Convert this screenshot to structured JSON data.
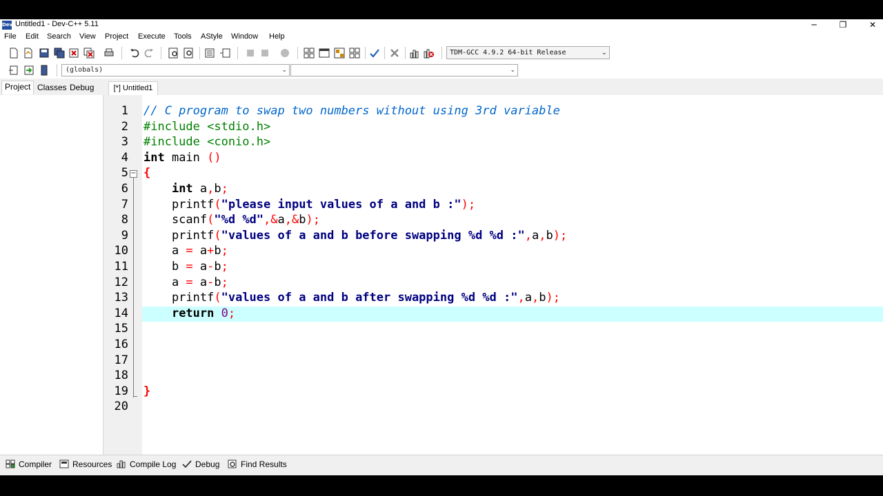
{
  "window": {
    "title": "Untitled1 - Dev-C++ 5.11",
    "app_icon": "Dev",
    "controls": [
      "─",
      "❐",
      "✕"
    ]
  },
  "menu": [
    "File",
    "Edit",
    "Search",
    "View",
    "Project",
    "Execute",
    "Tools",
    "AStyle",
    "Window",
    "Help"
  ],
  "toolbar": {
    "compiler": "TDM-GCC 4.9.2 64-bit Release",
    "scope": "(globals)",
    "member": ""
  },
  "left_tabs": [
    "Project",
    "Classes",
    "Debug"
  ],
  "editor": {
    "tab": "[*] Untitled1",
    "active_line": 14,
    "line_numbers": [
      "1",
      "2",
      "3",
      "4",
      "5",
      "6",
      "7",
      "8",
      "9",
      "10",
      "11",
      "12",
      "13",
      "14",
      "15",
      "16",
      "17",
      "18",
      "19",
      "20"
    ],
    "lines": [
      [
        {
          "t": "// C program to swap two numbers without using 3rd variable",
          "c": "comment"
        }
      ],
      [
        {
          "t": "#include <stdio.h>",
          "c": "pre"
        }
      ],
      [
        {
          "t": "#include <conio.h>",
          "c": "pre"
        }
      ],
      [
        {
          "t": "int",
          "c": "kw"
        },
        {
          "t": " main ",
          "c": "plain"
        },
        {
          "t": "()",
          "c": "sym"
        }
      ],
      [
        {
          "t": "{",
          "c": "brace"
        }
      ],
      [
        {
          "t": "    ",
          "c": "plain"
        },
        {
          "t": "int",
          "c": "kw"
        },
        {
          "t": " a",
          "c": "plain"
        },
        {
          "t": ",",
          "c": "sym"
        },
        {
          "t": "b",
          "c": "plain"
        },
        {
          "t": ";",
          "c": "sym"
        }
      ],
      [
        {
          "t": "    printf",
          "c": "plain"
        },
        {
          "t": "(",
          "c": "sym"
        },
        {
          "t": "\"please input values of a and b :\"",
          "c": "str"
        },
        {
          "t": ");",
          "c": "sym"
        }
      ],
      [
        {
          "t": "    scanf",
          "c": "plain"
        },
        {
          "t": "(",
          "c": "sym"
        },
        {
          "t": "\"%d %d\"",
          "c": "str"
        },
        {
          "t": ",&",
          "c": "sym"
        },
        {
          "t": "a",
          "c": "plain"
        },
        {
          "t": ",&",
          "c": "sym"
        },
        {
          "t": "b",
          "c": "plain"
        },
        {
          "t": ");",
          "c": "sym"
        }
      ],
      [
        {
          "t": "    printf",
          "c": "plain"
        },
        {
          "t": "(",
          "c": "sym"
        },
        {
          "t": "\"values of a and b before swapping %d %d :\"",
          "c": "str"
        },
        {
          "t": ",",
          "c": "sym"
        },
        {
          "t": "a",
          "c": "plain"
        },
        {
          "t": ",",
          "c": "sym"
        },
        {
          "t": "b",
          "c": "plain"
        },
        {
          "t": ");",
          "c": "sym"
        }
      ],
      [
        {
          "t": "    a ",
          "c": "plain"
        },
        {
          "t": "=",
          "c": "sym"
        },
        {
          "t": " a",
          "c": "plain"
        },
        {
          "t": "+",
          "c": "sym"
        },
        {
          "t": "b",
          "c": "plain"
        },
        {
          "t": ";",
          "c": "sym"
        }
      ],
      [
        {
          "t": "    b ",
          "c": "plain"
        },
        {
          "t": "=",
          "c": "sym"
        },
        {
          "t": " a",
          "c": "plain"
        },
        {
          "t": "-",
          "c": "sym"
        },
        {
          "t": "b",
          "c": "plain"
        },
        {
          "t": ";",
          "c": "sym"
        }
      ],
      [
        {
          "t": "    a ",
          "c": "plain"
        },
        {
          "t": "=",
          "c": "sym"
        },
        {
          "t": " a",
          "c": "plain"
        },
        {
          "t": "-",
          "c": "sym"
        },
        {
          "t": "b",
          "c": "plain"
        },
        {
          "t": ";",
          "c": "sym"
        }
      ],
      [
        {
          "t": "    printf",
          "c": "plain"
        },
        {
          "t": "(",
          "c": "sym"
        },
        {
          "t": "\"values of a and b after swapping %d %d :\"",
          "c": "str"
        },
        {
          "t": ",",
          "c": "sym"
        },
        {
          "t": "a",
          "c": "plain"
        },
        {
          "t": ",",
          "c": "sym"
        },
        {
          "t": "b",
          "c": "plain"
        },
        {
          "t": ");",
          "c": "sym"
        }
      ],
      [
        {
          "t": "    ",
          "c": "plain"
        },
        {
          "t": "return",
          "c": "kw"
        },
        {
          "t": " ",
          "c": "plain"
        },
        {
          "t": "0",
          "c": "num"
        },
        {
          "t": ";",
          "c": "sym"
        }
      ],
      [],
      [],
      [],
      [],
      [
        {
          "t": "}",
          "c": "brace"
        }
      ],
      []
    ]
  },
  "bottom_tabs": [
    "Compiler",
    "Resources",
    "Compile Log",
    "Debug",
    "Find Results"
  ]
}
